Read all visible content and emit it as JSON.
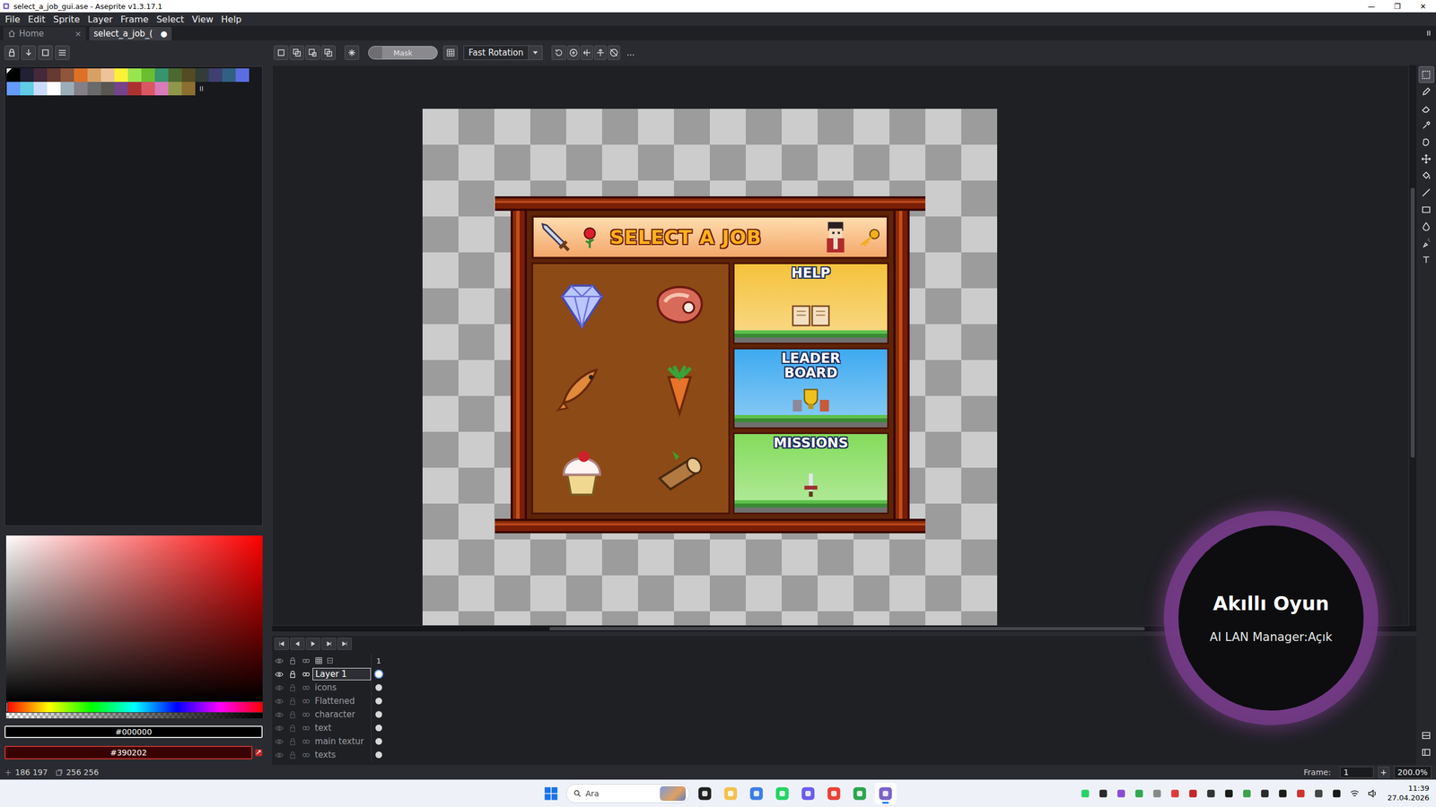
{
  "window": {
    "title": "select_a_job_gui.ase - Aseprite v1.3.17.1",
    "controls": [
      "—",
      "❐",
      "✕"
    ]
  },
  "menu": [
    "File",
    "Edit",
    "Sprite",
    "Layer",
    "Frame",
    "Select",
    "View",
    "Help"
  ],
  "tabs": [
    {
      "label": "Home",
      "kind": "home",
      "marker": "×",
      "selected": false
    },
    {
      "label": "select_a_job_(",
      "kind": "file",
      "marker": "●",
      "selected": true
    }
  ],
  "context_bar": {
    "mask": "Mask",
    "rotation": "Fast Rotation",
    "more": "..."
  },
  "palette": [
    {
      "color": "#000000",
      "selected": true
    },
    {
      "color": "#222034",
      "selected": false
    },
    {
      "color": "#45283c",
      "selected": false
    },
    {
      "color": "#663931",
      "selected": false
    },
    {
      "color": "#8f563b",
      "selected": false
    },
    {
      "color": "#df7126",
      "selected": false
    },
    {
      "color": "#d9a066",
      "selected": false
    },
    {
      "color": "#eec39a",
      "selected": false
    },
    {
      "color": "#fbf236",
      "selected": false
    },
    {
      "color": "#99e550",
      "selected": false
    },
    {
      "color": "#6abe30",
      "selected": false
    },
    {
      "color": "#37946e",
      "selected": false
    },
    {
      "color": "#4b692f",
      "selected": false
    },
    {
      "color": "#524b24",
      "selected": false
    },
    {
      "color": "#323c39",
      "selected": false
    },
    {
      "color": "#3f3f74",
      "selected": false
    },
    {
      "color": "#306082",
      "selected": false
    },
    {
      "color": "#5b6ee1",
      "selected": false
    },
    {
      "color": "#639bff",
      "selected": false
    },
    {
      "color": "#5fcde4",
      "selected": false
    },
    {
      "color": "#cbdbfc",
      "selected": false
    },
    {
      "color": "#ffffff",
      "selected": false
    },
    {
      "color": "#9badb7",
      "selected": false
    },
    {
      "color": "#847e87",
      "selected": false
    },
    {
      "color": "#696a6a",
      "selected": false
    },
    {
      "color": "#595652",
      "selected": false
    },
    {
      "color": "#76428a",
      "selected": false
    },
    {
      "color": "#ac3232",
      "selected": false
    },
    {
      "color": "#d95763",
      "selected": false
    },
    {
      "color": "#d77bba",
      "selected": false
    },
    {
      "color": "#8f974a",
      "selected": false
    },
    {
      "color": "#8a6f30",
      "selected": false
    }
  ],
  "colors": {
    "foreground": "#000000",
    "background": "#390202"
  },
  "sprite": {
    "title": "SELECT A JOB",
    "menu": [
      {
        "lines": [
          "HELP"
        ],
        "color": "#f5c23c"
      },
      {
        "lines": [
          "LEADER",
          "BOARD"
        ],
        "color": "#3eaaf0"
      },
      {
        "lines": [
          "MISSIONS"
        ],
        "color": "#84dc5c"
      }
    ]
  },
  "tools": [
    {
      "kind": "marquee",
      "selected": true
    },
    {
      "kind": "pencil",
      "selected": false
    },
    {
      "kind": "eraser",
      "selected": false
    },
    {
      "kind": "eyedropper",
      "selected": false
    },
    {
      "kind": "contour",
      "selected": false
    },
    {
      "kind": "move",
      "selected": false
    },
    {
      "kind": "bucket",
      "selected": false
    },
    {
      "kind": "line",
      "selected": false
    },
    {
      "kind": "rectangle",
      "selected": false
    },
    {
      "kind": "blur",
      "selected": false
    },
    {
      "kind": "spray",
      "selected": false
    },
    {
      "kind": "text",
      "selected": false
    }
  ],
  "timeline": {
    "frame": "1",
    "layers": [
      {
        "name": "Layer 1",
        "selected": true
      },
      {
        "name": "icons",
        "selected": false
      },
      {
        "name": "Flattened",
        "selected": false
      },
      {
        "name": "character",
        "selected": false
      },
      {
        "name": "text",
        "selected": false
      },
      {
        "name": "main textur",
        "selected": false
      },
      {
        "name": "texts",
        "selected": false
      }
    ]
  },
  "status_bar": {
    "position": "186 197",
    "size": "256 256",
    "frame_label": "Frame:",
    "frame": "1",
    "add": "+",
    "zoom": "200.0%"
  },
  "taskbar": {
    "search": "Ara",
    "apps": [
      {
        "kind": "taskview",
        "active": false
      },
      {
        "kind": "explorer",
        "active": false
      },
      {
        "kind": "notepad",
        "active": false
      },
      {
        "kind": "whatsapp",
        "active": false
      },
      {
        "kind": "discord",
        "active": false
      },
      {
        "kind": "chrome",
        "active": false
      },
      {
        "kind": "xbox",
        "active": false
      },
      {
        "kind": "aseprite",
        "active": true
      }
    ],
    "time": "11:39",
    "date": "27.04.2026"
  },
  "overlay": {
    "title": "Akıllı Oyun",
    "subtitle": "AI LAN Manager:Açık"
  }
}
